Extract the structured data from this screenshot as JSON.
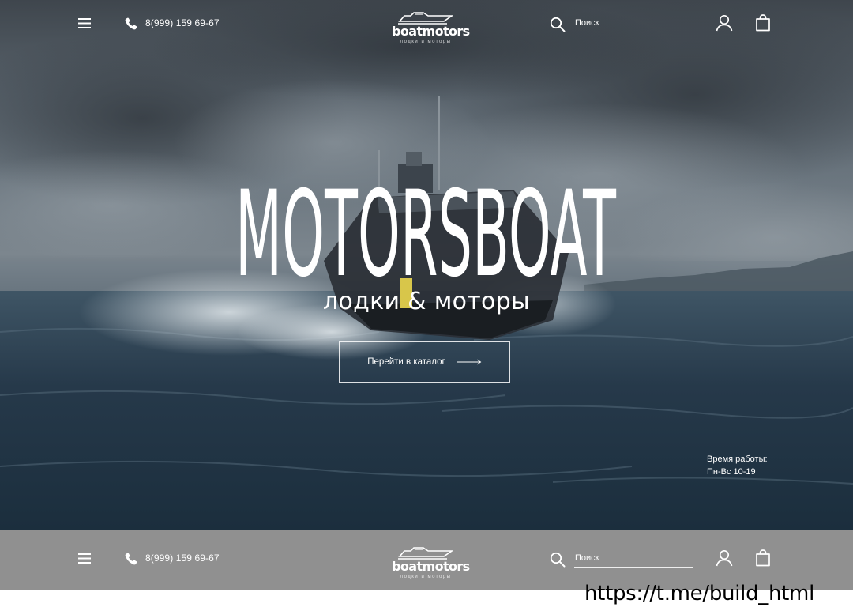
{
  "header": {
    "phone": "8(999) 159 69-67",
    "logo_text": "boatmotors",
    "logo_subtext": "лодки и моторы",
    "search_placeholder": "Поиск",
    "icons": [
      "menu-icon",
      "phone-icon",
      "search-icon",
      "user-icon",
      "cart-icon"
    ]
  },
  "hero": {
    "title": "MOTORSBOAT",
    "subtitle": "лодки & моторы",
    "cta_label": "Перейти в каталог",
    "hours_label": "Время работы:",
    "hours_value": "Пн-Вс 10-19"
  },
  "sticky_header": {
    "phone": "8(999) 159 69-67",
    "logo_text": "boatmotors",
    "logo_subtext": "лодки и моторы",
    "search_placeholder": "Поиск"
  },
  "watermark": "https://t.me/build_html",
  "colors": {
    "strip_bg": "#909090",
    "text": "#ffffff",
    "watermark": "#000000"
  }
}
